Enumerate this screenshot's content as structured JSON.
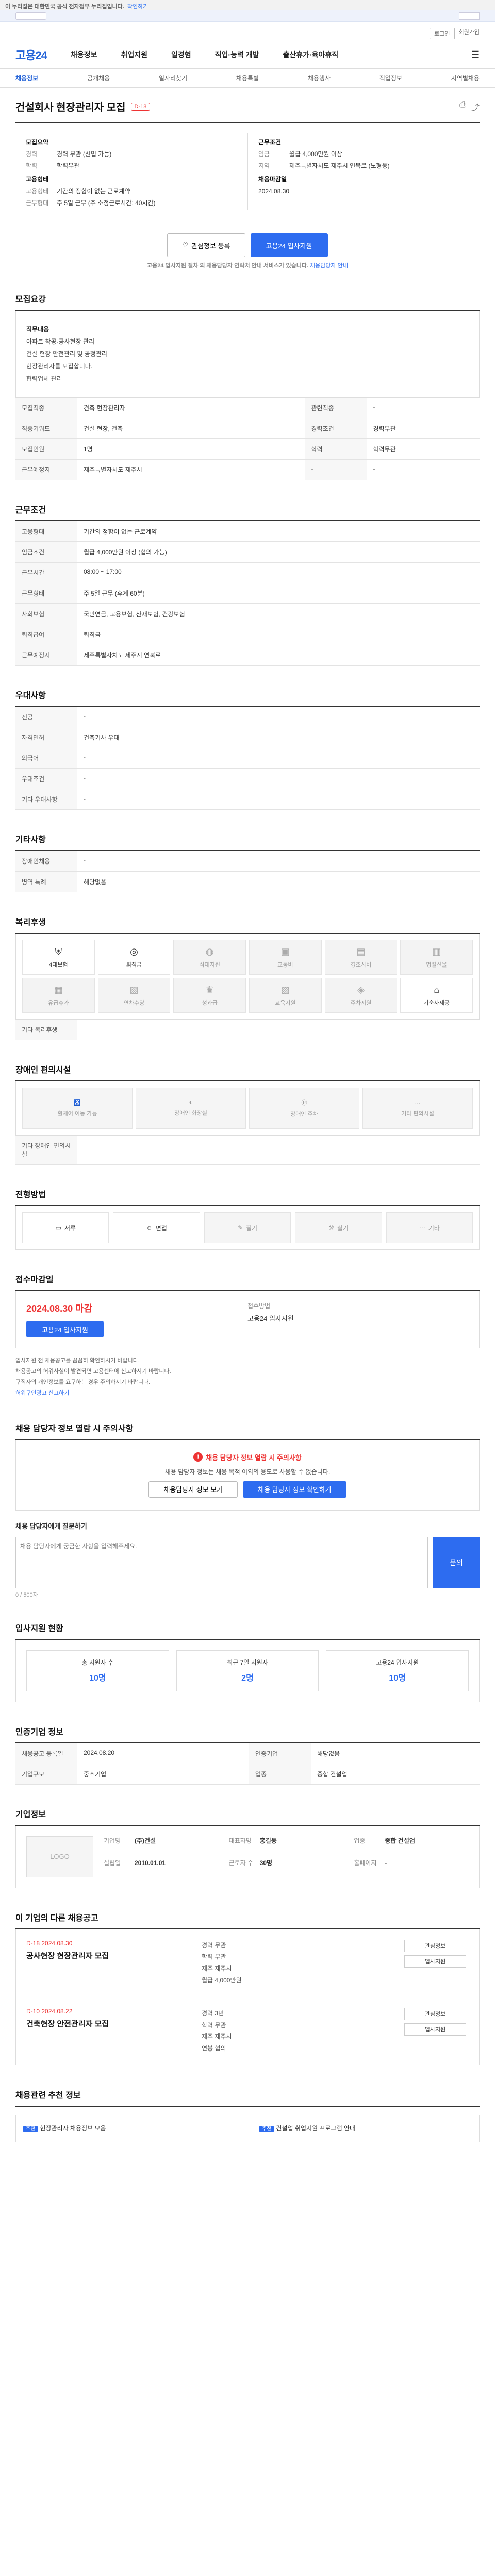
{
  "topbar": {
    "text": "이 누리집은 대한민국 공식 전자정부 누리집입니다.",
    "link": "확인하기"
  },
  "header": {
    "links": [
      "로그인",
      "회원가입"
    ]
  },
  "nav": {
    "logo": "고용24",
    "items": [
      "채용정보",
      "취업지원",
      "일경험",
      "직업·능력 개발",
      "출산휴가·육아휴직"
    ]
  },
  "subnav": [
    "채용정보",
    "공개채용",
    "일자리찾기",
    "채용특별",
    "채용행사",
    "직업정보",
    "지역별채용"
  ],
  "job": {
    "title": "건설회사 현장관리자 모집",
    "dday": "D-18",
    "recruit": {
      "header": "모집요약",
      "rows": [
        [
          "경력",
          "경력 무관 (신입 가능)"
        ],
        [
          "학력",
          "학력무관"
        ]
      ]
    },
    "company_info": {
      "header": "고용형태",
      "rows": [
        [
          "고용형태",
          "기간의 정함이 없는 근로계약"
        ],
        [
          "근무형태",
          "주 5일 근무 (주 소정근로시간: 40시간)"
        ]
      ]
    },
    "wage": {
      "header": "근무조건",
      "rows": [
        [
          "임금",
          "월급 4,000만원 이상"
        ],
        [
          "지역",
          "제주특별자치도 제주시 연북로 (노형동)"
        ]
      ]
    },
    "apply_period_label": "채용마감일",
    "apply_period": "2024.08.30"
  },
  "buttons": {
    "scrap": "관심정보 등록",
    "apply": "고용24 입사지원"
  },
  "notice": {
    "text": "고용24 입사지원 절차 외 채용담당자 연락처 안내 서비스가 있습니다.",
    "link": "채용담당자 안내"
  },
  "duty": {
    "title": "모집요강",
    "subtitle": "직무내용",
    "lines": [
      "아파트 착공·공사현장 관리",
      "건설 현장 안전관리 및 공정관리",
      "현장관리자를 모집합니다.",
      "협력업체 관리"
    ]
  },
  "duty_table": {
    "rows": [
      [
        "모집직종",
        "건축 현장관리자",
        "관련직종",
        "-"
      ],
      [
        "직종키워드",
        "건설 현장, 건축",
        "경력조건",
        "경력무관"
      ],
      [
        "모집인원",
        "1명",
        "학력",
        "학력무관"
      ],
      [
        "근무예정지",
        "제주특별자치도 제주시",
        "-",
        "-"
      ]
    ]
  },
  "conditions": {
    "title": "근무조건",
    "rows": [
      [
        "고용형태",
        "기간의 정함이 없는 근로계약"
      ],
      [
        "임금조건",
        "월급 4,000만원 이상 (협의 가능)"
      ],
      [
        "근무시간",
        "08:00 ~ 17:00"
      ],
      [
        "근무형태",
        "주 5일 근무 (휴게 60분)"
      ],
      [
        "사회보험",
        "국민연금, 고용보험, 산재보험, 건강보험"
      ],
      [
        "퇴직급여",
        "퇴직금"
      ],
      [
        "근무예정지",
        "제주특별자치도 제주시 연북로"
      ]
    ]
  },
  "benefits": {
    "title": "우대사항",
    "rows": [
      [
        "전공",
        "-"
      ],
      [
        "자격면허",
        "건축기사 우대"
      ],
      [
        "외국어",
        "-"
      ],
      [
        "우대조건",
        "-"
      ],
      [
        "기타 우대사항",
        "-"
      ]
    ]
  },
  "etc": {
    "title": "기타사항",
    "rows": [
      [
        "장애인채용",
        "-"
      ],
      [
        "병역 특례",
        "해당없음"
      ]
    ]
  },
  "welfare": {
    "title": "복리후생",
    "items": [
      "4대보험",
      "퇴직금",
      "식대지원",
      "교통비",
      "경조사비",
      "명절선물",
      "유급휴가",
      "연차수당",
      "성과급",
      "교육지원",
      "주차지원",
      "기숙사제공"
    ]
  },
  "welfare_other": "기타 복리후생",
  "disabled": {
    "title": "장애인 편의시설",
    "items": [
      "휠체어 이동 가능",
      "장애인 화장실",
      "장애인 주차",
      "기타 편의시설"
    ]
  },
  "disabled_other": "기타 장애인 편의시설",
  "process": {
    "title": "전형방법",
    "items": [
      "서류",
      "면접",
      "필기",
      "실기",
      "기타"
    ]
  },
  "period": {
    "title": "접수마감일",
    "date": "2024.08.30 마감",
    "label2": "접수방법",
    "value2": "고용24 입사지원"
  },
  "warnings": [
    "입사지원 전 채용공고를 꼼꼼히 확인하시기 바랍니다.",
    "채용공고의 허위사실이 발견되면 고용센터에 신고하시기 바랍니다.",
    "구직자의 개인정보를 요구하는 경우 주의하시기 바랍니다."
  ],
  "warnings_link": "허위구인광고 신고하기",
  "apply_box": {
    "alert": "채용 담당자 정보 열람 시 주의사항",
    "text": "채용 담당자 정보는 채용 목적 이외의 용도로 사용할 수 없습니다.",
    "btn1": "채용담당자 정보 보기",
    "btn2": "채용 담당자 정보 확인하기"
  },
  "qa": {
    "title": "채용 담당자에게 질문하기",
    "placeholder": "채용 담당자에게 궁금한 사항을 입력해주세요.",
    "send": "문의",
    "count": "0 / 500자"
  },
  "stats": {
    "title": "입사지원 현황",
    "items": [
      [
        "총 지원자 수",
        "10명"
      ],
      [
        "최근 7일 지원자",
        "2명"
      ],
      [
        "고용24 입사지원",
        "10명"
      ]
    ]
  },
  "manager": {
    "title": "인증기업 정보",
    "rows": [
      [
        "채용공고 등록일",
        "2024.08.20",
        "인증기업",
        "해당없음"
      ],
      [
        "기업규모",
        "중소기업",
        "업종",
        "종합 건설업"
      ]
    ]
  },
  "company": {
    "title": "기업정보",
    "logo": "LOGO",
    "rows": [
      [
        "기업명",
        "(주)건설",
        "대표자명",
        "홍길동"
      ],
      [
        "업종",
        "종합 건설업",
        "설립일",
        "2010.01.01"
      ],
      [
        "근로자 수",
        "30명",
        "홈페이지",
        "-"
      ]
    ]
  },
  "other_jobs": {
    "title": "이 기업의 다른 채용공고",
    "items": [
      {
        "tag": "D-18 2024.08.30",
        "title": "공사현장 현장관리자 모집",
        "meta": [
          "경력 무관",
          "학력 무관",
          "제주 제주시",
          "월급 4,000만원"
        ]
      },
      {
        "tag": "D-10 2024.08.22",
        "title": "건축현장 안전관리자 모집",
        "meta": [
          "경력 3년",
          "학력 무관",
          "제주 제주시",
          "연봉 협의"
        ]
      }
    ],
    "btns": [
      "관심정보",
      "입사지원"
    ]
  },
  "promo": {
    "title": "채용관련 추천 정보",
    "cards": [
      {
        "badge": "추천",
        "text": "현장관리자 채용정보 모음"
      },
      {
        "badge": "추천",
        "text": "건설업 취업지원 프로그램 안내"
      }
    ]
  }
}
